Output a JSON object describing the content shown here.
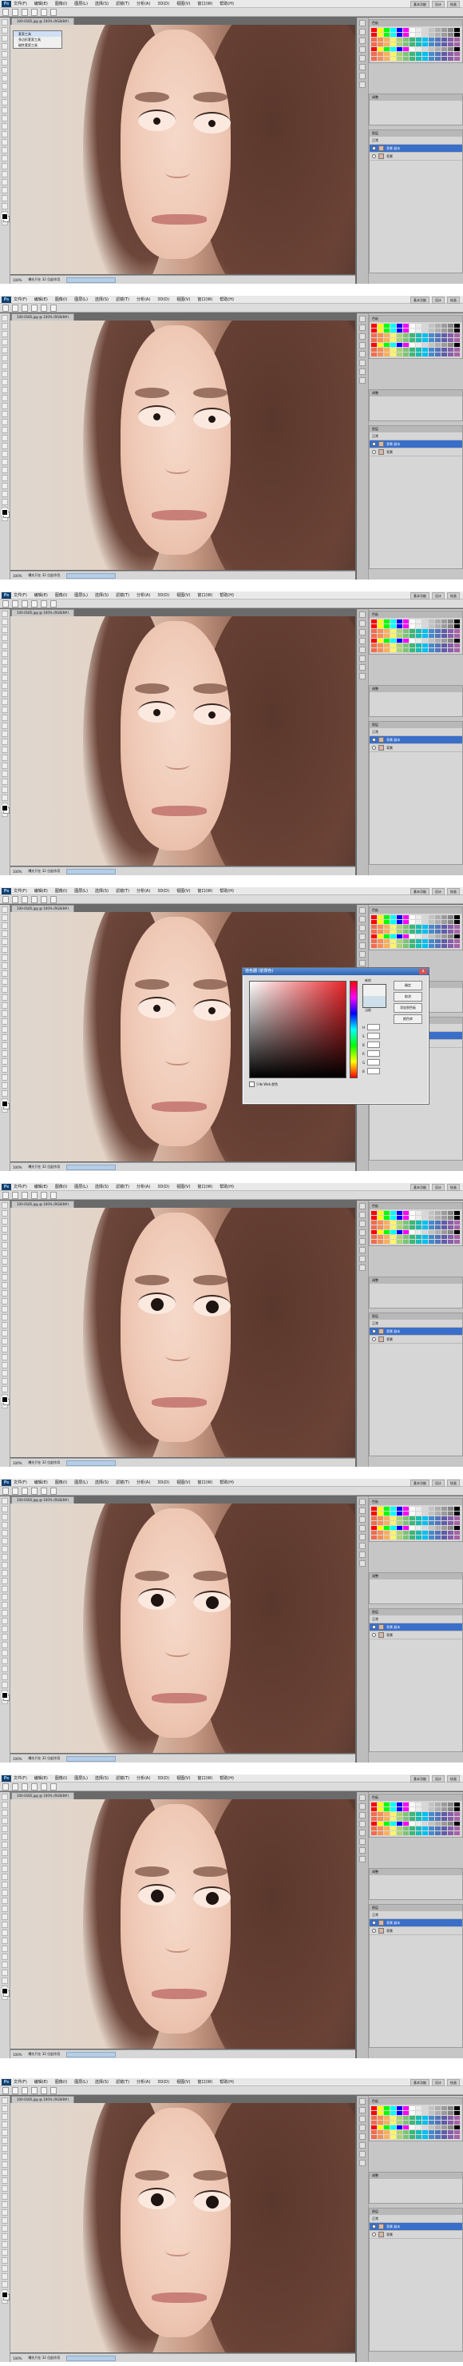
{
  "app": {
    "logo_label": "Ps",
    "menu": [
      "文件(F)",
      "编辑(E)",
      "图像(I)",
      "图层(L)",
      "选择(S)",
      "滤镜(T)",
      "分析(A)",
      "3D(D)",
      "视图(V)",
      "窗口(W)",
      "帮助(H)"
    ],
    "workspace_buttons": [
      "基本功能",
      "设计",
      "绘画"
    ],
    "doc_tab": "100-0185.jpg @ 100% (RGB/8#)",
    "status_zoom": "100%",
    "status_text": "曝光只在 32 位起作用"
  },
  "tool_popup": {
    "items": [
      "套索工具",
      "多边形套索工具",
      "磁性套索工具"
    ]
  },
  "panels": {
    "swatches_title": "色板",
    "adjust_title": "调整",
    "layers_title": "图层",
    "layer_items": [
      "背景 副本",
      "背景"
    ],
    "layer_mode": "正常"
  },
  "color_picker": {
    "title": "拾色器 (前景色)",
    "close_label": "x",
    "buttons": [
      "确定",
      "取消",
      "添加到色板",
      "颜色库"
    ],
    "new_label": "新的",
    "current_label": "当前",
    "only_web": "只有 Web 颜色",
    "fields": [
      "H",
      "S",
      "B",
      "R",
      "G",
      "B"
    ]
  },
  "colors": {
    "selection_blue": "#3a6fc9",
    "accent_red": "#e8262a"
  },
  "swatch_colors": [
    "#ff0000",
    "#ffff00",
    "#00ff00",
    "#00ffff",
    "#0000ff",
    "#ff00ff",
    "#ffffff",
    "#ebebeb",
    "#d7d7d7",
    "#c3c3c3",
    "#afafaf",
    "#9b9b9b",
    "#878787",
    "#000000",
    "#f26c4f",
    "#f68e56",
    "#fbaf5d",
    "#fff568",
    "#acd372",
    "#7cc576",
    "#3bb878",
    "#1abbb4",
    "#00bff3",
    "#438ccb",
    "#5574b9",
    "#605ca8",
    "#855fa8",
    "#a763a8"
  ],
  "frames": [
    {
      "label": "frame-1"
    },
    {
      "label": "frame-2"
    },
    {
      "label": "frame-3"
    },
    {
      "label": "frame-4"
    },
    {
      "label": "frame-5"
    },
    {
      "label": "frame-6"
    },
    {
      "label": "frame-7"
    },
    {
      "label": "frame-8"
    }
  ]
}
